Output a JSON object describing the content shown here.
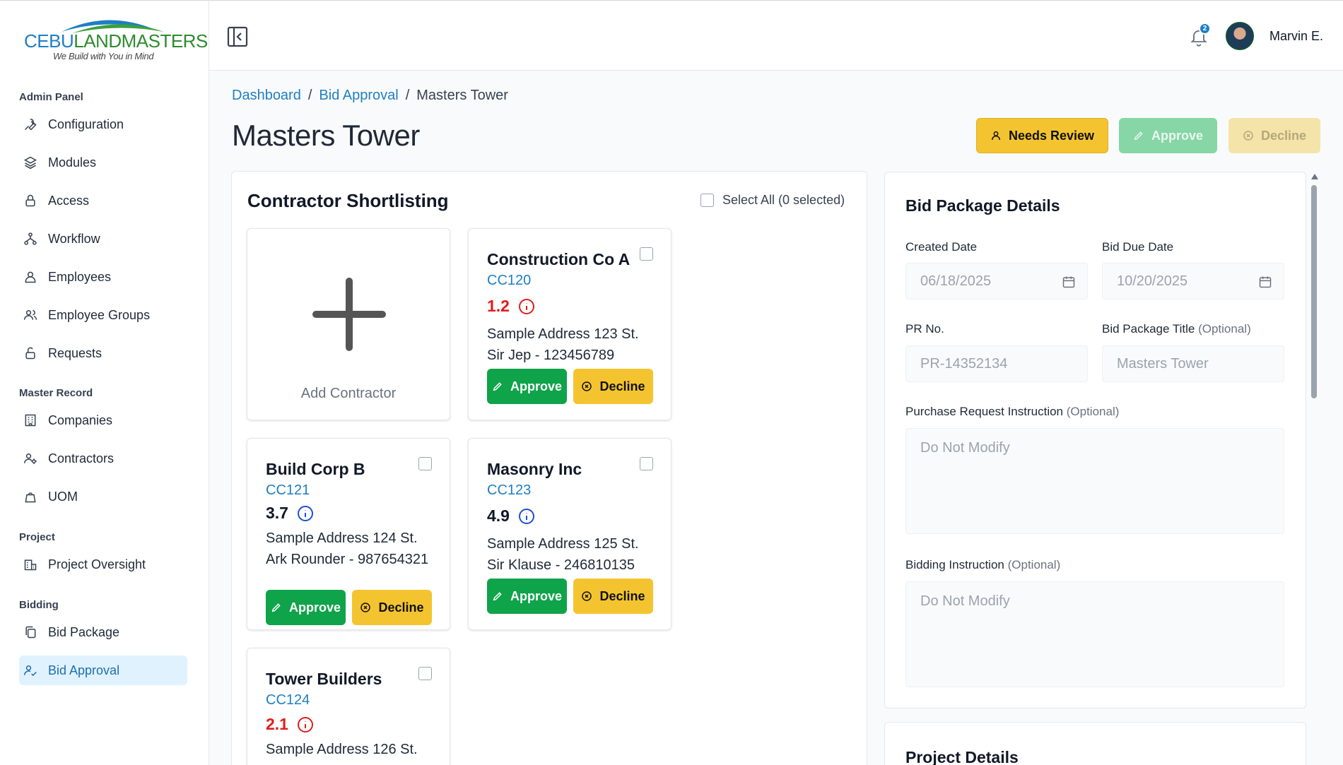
{
  "brand": {
    "name_part1": "CEBU",
    "name_part2": "LANDMASTERS",
    "tagline": "We Build with You in Mind",
    "colors": {
      "primary": "#1e7fc4",
      "secondary": "#2e8b2e"
    }
  },
  "sidebar": {
    "sections": [
      {
        "title": "Admin Panel",
        "items": [
          {
            "label": "Configuration",
            "icon": "wrench-icon"
          },
          {
            "label": "Modules",
            "icon": "layers-icon"
          },
          {
            "label": "Access",
            "icon": "lock-icon"
          },
          {
            "label": "Workflow",
            "icon": "workflow-icon"
          },
          {
            "label": "Employees",
            "icon": "user-icon"
          },
          {
            "label": "Employee Groups",
            "icon": "users-icon"
          },
          {
            "label": "Requests",
            "icon": "unlock-icon"
          }
        ]
      },
      {
        "title": "Master Record",
        "items": [
          {
            "label": "Companies",
            "icon": "building-icon"
          },
          {
            "label": "Contractors",
            "icon": "user-cog-icon"
          },
          {
            "label": "UOM",
            "icon": "weight-icon"
          }
        ]
      },
      {
        "title": "Project",
        "items": [
          {
            "label": "Project Oversight",
            "icon": "chart-building-icon"
          }
        ]
      },
      {
        "title": "Bidding",
        "items": [
          {
            "label": "Bid Package",
            "icon": "copy-icon"
          },
          {
            "label": "Bid Approval",
            "icon": "user-check-icon",
            "active": true
          }
        ]
      }
    ]
  },
  "topbar": {
    "notification_count": "2",
    "user_name": "Marvin E."
  },
  "breadcrumb": {
    "items": [
      "Dashboard",
      "Bid Approval",
      "Masters Tower"
    ],
    "separator": "/"
  },
  "page": {
    "title": "Masters Tower",
    "actions": {
      "needs_review": "Needs Review",
      "approve": "Approve",
      "decline": "Decline"
    }
  },
  "shortlist": {
    "title": "Contractor Shortlisting",
    "select_all_label": "Select All (0 selected)",
    "add_label": "Add Contractor",
    "approve_label": "Approve",
    "decline_label": "Decline",
    "contractors": [
      {
        "name": "Construction Co A",
        "code": "CC120",
        "score": "1.2",
        "score_level": "low",
        "address": "Sample Address 123 St.",
        "contact": "Sir Jep - 123456789"
      },
      {
        "name": "Build Corp B",
        "code": "CC121",
        "score": "3.7",
        "score_level": "ok",
        "address": "Sample Address 124 St.",
        "contact": "Ark Rounder - 987654321"
      },
      {
        "name": "Masonry Inc",
        "code": "CC123",
        "score": "4.9",
        "score_level": "ok",
        "address": "Sample Address 125 St.",
        "contact": "Sir Klause - 246810135"
      },
      {
        "name": "Tower Builders",
        "code": "CC124",
        "score": "2.1",
        "score_level": "low",
        "address": "Sample Address 126 St.",
        "contact": ""
      }
    ]
  },
  "bid_package": {
    "title": "Bid Package Details",
    "created_date_label": "Created Date",
    "created_date": "06/18/2025",
    "due_date_label": "Bid Due Date",
    "due_date": "10/20/2025",
    "pr_no_label": "PR No.",
    "pr_no_placeholder": "PR-14352134",
    "title_label": "Bid Package Title",
    "optional_label": "(Optional)",
    "title_placeholder": "Masters Tower",
    "pr_instruction_label": "Purchase Request Instruction",
    "pr_instruction_placeholder": "Do Not Modify",
    "bidding_instruction_label": "Bidding Instruction",
    "bidding_instruction_placeholder": "Do Not Modify"
  },
  "project_details": {
    "title": "Project Details"
  }
}
